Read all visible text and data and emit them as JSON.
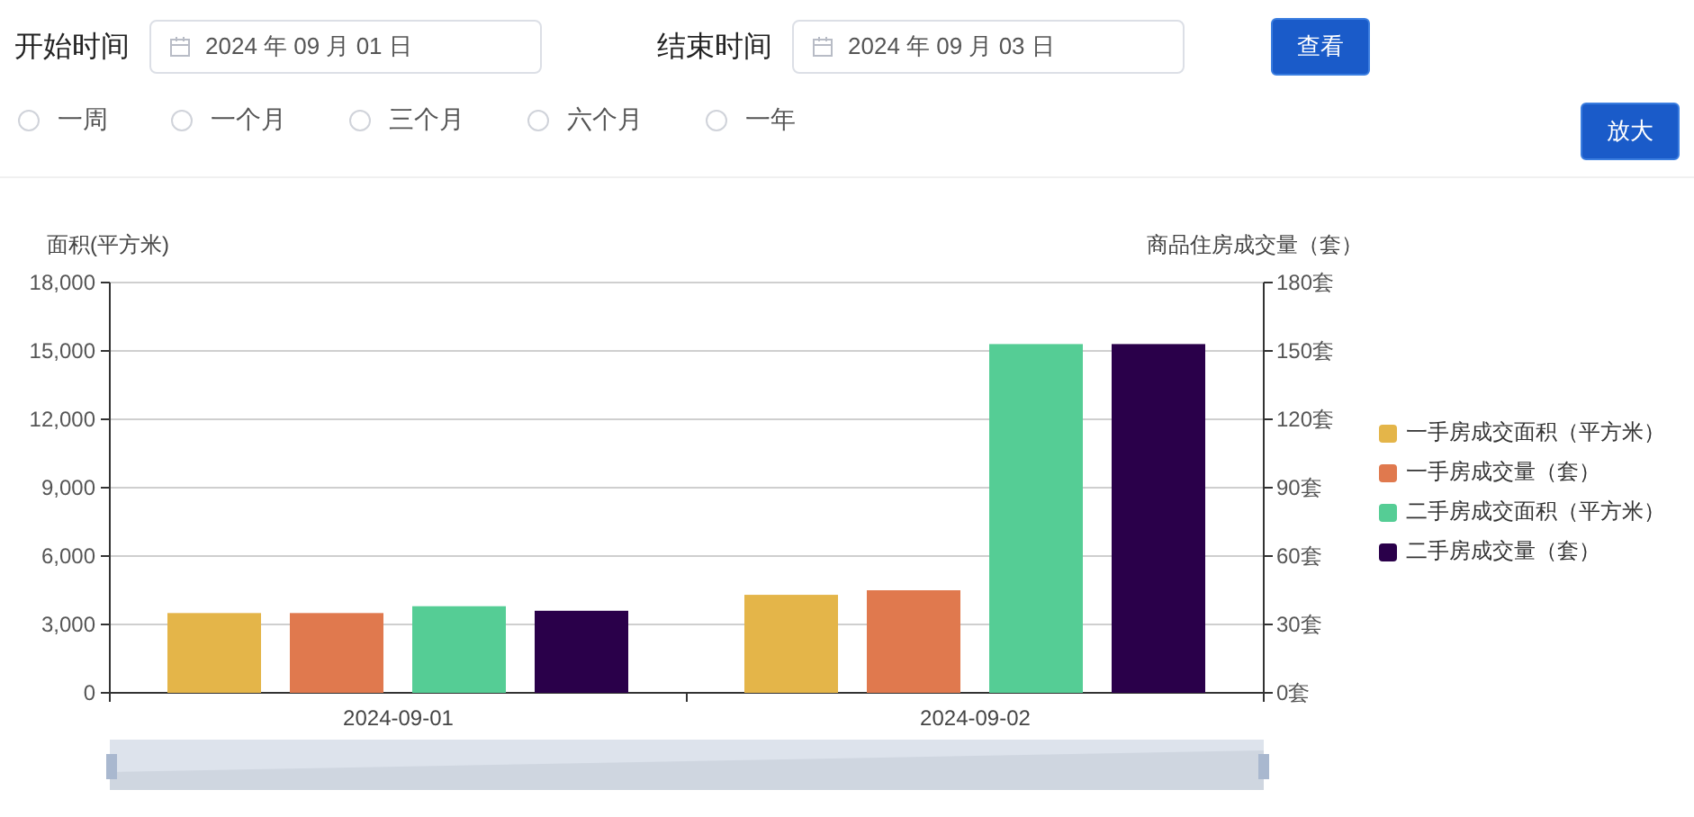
{
  "filters": {
    "start_label": "开始时间",
    "start_date": "2024 年 09 月 01 日",
    "end_label": "结束时间",
    "end_date": "2024 年 09 月 03 日",
    "view_button": "查看"
  },
  "ranges": [
    {
      "label": "一周",
      "selected": false
    },
    {
      "label": "一个月",
      "selected": false
    },
    {
      "label": "三个月",
      "selected": false
    },
    {
      "label": "六个月",
      "selected": false
    },
    {
      "label": "一年",
      "selected": false
    }
  ],
  "zoom_button": "放大",
  "chart": {
    "chart_data": {
      "type": "bar",
      "ylabel": "面积(平方米)",
      "y2label": "商品住房成交量（套）",
      "categories": [
        "2024-09-01",
        "2024-09-02"
      ],
      "ylim": [
        0,
        18000
      ],
      "grid": true,
      "y2lim": [
        0,
        180
      ],
      "yticks": [
        {
          "value": 0,
          "label": "0"
        },
        {
          "value": 3000,
          "label": "3,000"
        },
        {
          "value": 6000,
          "label": "6,000"
        },
        {
          "value": 9000,
          "label": "9,000"
        },
        {
          "value": 12000,
          "label": "12,000"
        },
        {
          "value": 15000,
          "label": "15,000"
        },
        {
          "value": 18000,
          "label": "18,000"
        }
      ],
      "y2ticks": [
        {
          "value": 0,
          "label": "0套"
        },
        {
          "value": 30,
          "label": "30套"
        },
        {
          "value": 60,
          "label": "60套"
        },
        {
          "value": 90,
          "label": "90套"
        },
        {
          "value": 120,
          "label": "120套"
        },
        {
          "value": 150,
          "label": "150套"
        },
        {
          "value": 180,
          "label": "180套"
        }
      ],
      "series": [
        {
          "name": "一手房成交面积（平方米）",
          "color": "#e4b549",
          "values": [
            3500,
            4300
          ]
        },
        {
          "name": "一手房成交量（套）",
          "color": "#e0794e",
          "axis": "y2",
          "values": [
            35,
            45
          ]
        },
        {
          "name": "二手房成交面积（平方米）",
          "color": "#55cd95",
          "values": [
            3800,
            15300
          ]
        },
        {
          "name": "二手房成交量（套）",
          "color": "#2a004a",
          "axis": "y2",
          "values": [
            36,
            153
          ]
        }
      ]
    }
  }
}
